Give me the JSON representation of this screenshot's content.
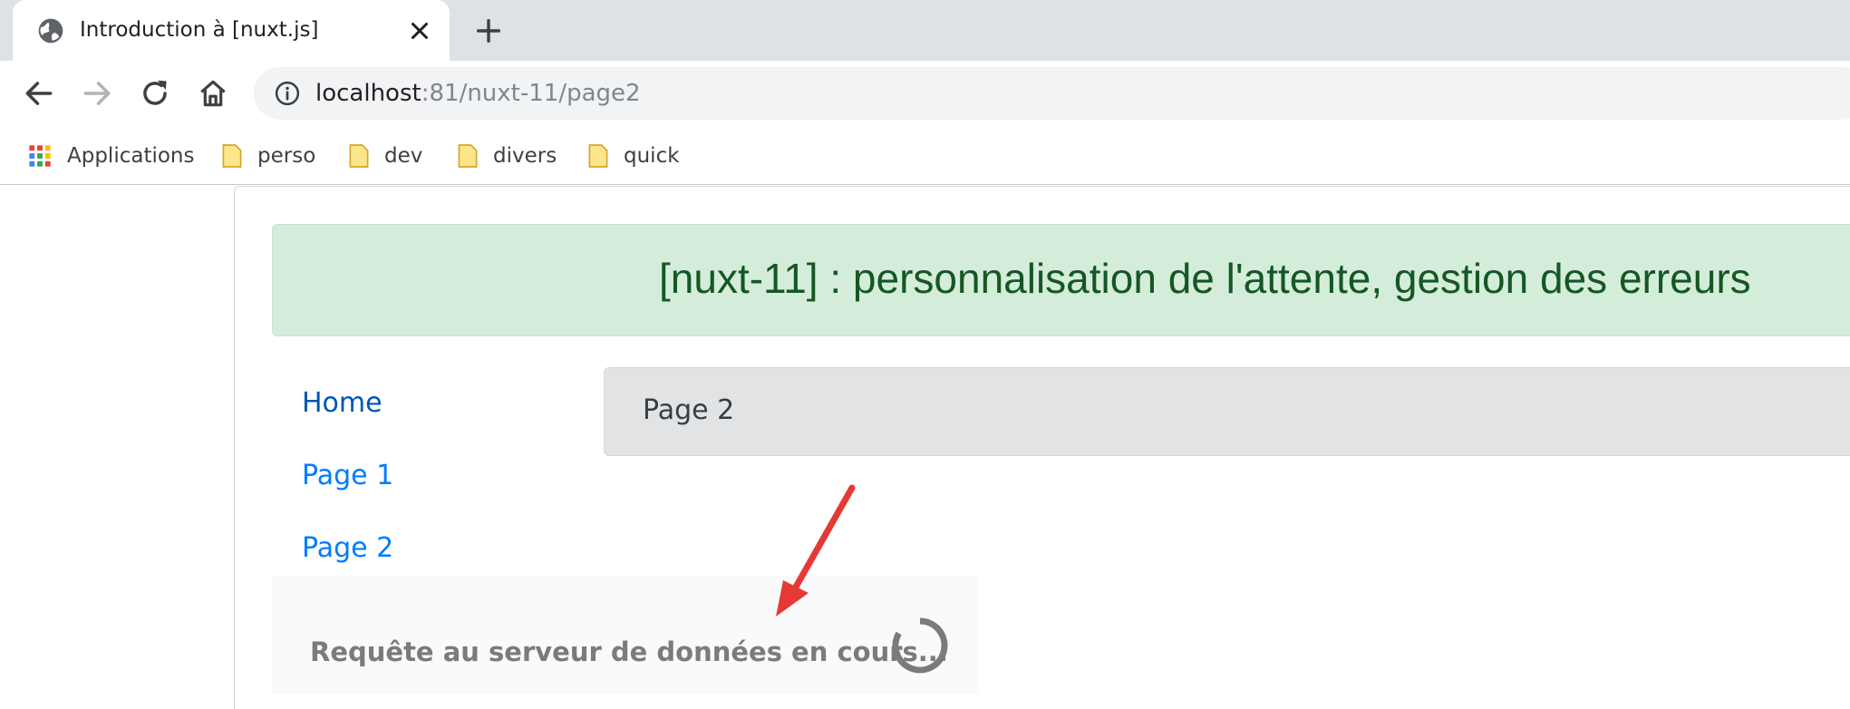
{
  "browser": {
    "tab": {
      "title": "Introduction à [nuxt.js]",
      "favicon": "globe-icon",
      "close": "close-icon"
    },
    "new_tab": "plus-icon",
    "nav": {
      "back": "arrow-left-icon",
      "forward": "arrow-right-icon",
      "reload": "reload-icon",
      "home": "home-icon"
    },
    "address": {
      "security": "info-icon",
      "host": "localhost",
      "rest": ":81/nuxt-11/page2"
    },
    "bookmarks": [
      {
        "label": "Applications",
        "icon": "apps-grid-icon"
      },
      {
        "label": "perso",
        "icon": "folder-icon"
      },
      {
        "label": "dev",
        "icon": "folder-icon"
      },
      {
        "label": "divers",
        "icon": "folder-icon"
      },
      {
        "label": "quick",
        "icon": "folder-icon"
      }
    ]
  },
  "page": {
    "header_title": "[nuxt-11] : personnalisation de l'attente, gestion des erreurs",
    "menu": [
      {
        "label": "Home"
      },
      {
        "label": "Page 1"
      },
      {
        "label": "Page 2"
      }
    ],
    "current_page": "Page 2",
    "loading_message": "Requête au serveur de données en cours...",
    "colors": {
      "alert_bg": "#d4edda",
      "alert_text": "#155724",
      "link": "#007bff",
      "panel_bg": "#e2e3e5",
      "annotation_arrow": "#e53935"
    }
  }
}
